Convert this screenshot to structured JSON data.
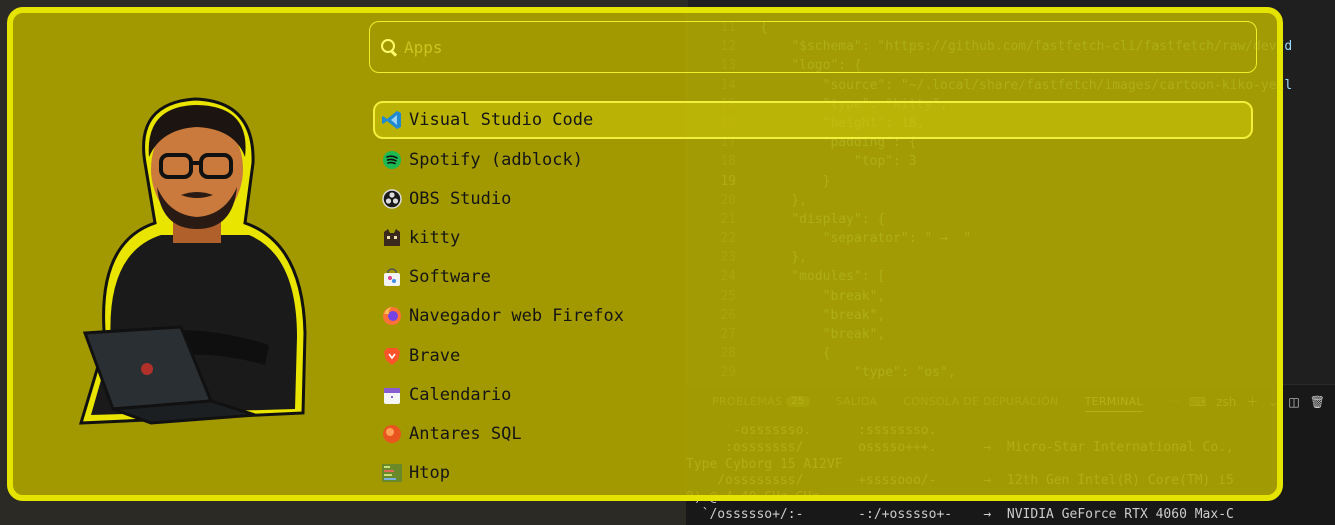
{
  "launcher": {
    "search_placeholder": "Apps",
    "apps": [
      {
        "label": "Visual Studio Code",
        "icon": "vscode-icon",
        "selected": true
      },
      {
        "label": "Spotify (adblock)",
        "icon": "spotify-icon"
      },
      {
        "label": "OBS Studio",
        "icon": "obs-icon"
      },
      {
        "label": "kitty",
        "icon": "kitty-icon"
      },
      {
        "label": "Software",
        "icon": "software-store-icon"
      },
      {
        "label": "Navegador web Firefox",
        "icon": "firefox-icon"
      },
      {
        "label": "Brave",
        "icon": "brave-icon"
      },
      {
        "label": "Calendario",
        "icon": "calendar-icon"
      },
      {
        "label": "Antares SQL",
        "icon": "antares-icon"
      },
      {
        "label": "Htop",
        "icon": "htop-icon"
      }
    ]
  },
  "editor": {
    "lines": [
      {
        "n": "11",
        "t": "{"
      },
      {
        "n": "12",
        "t": "    \"$schema\": \"https://github.com/fastfetch-cli/fastfetch/raw/dev/d"
      },
      {
        "n": "13",
        "t": "    \"logo\": {"
      },
      {
        "n": "14",
        "t": "        \"source\": \"~/.local/share/fastfetch/images/cartoon-kiko-yell"
      },
      {
        "n": "15",
        "t": "        \"type\": \"kitty\","
      },
      {
        "n": "16",
        "t": "        \"height\": 18,"
      },
      {
        "n": "17",
        "t": "        \"padding\": {"
      },
      {
        "n": "18",
        "t": "            \"top\": 3"
      },
      {
        "n": "19",
        "t": "        }"
      },
      {
        "n": "20",
        "t": "    },"
      },
      {
        "n": "21",
        "t": "    \"display\": {"
      },
      {
        "n": "22",
        "t": "        \"separator\": \" →  \""
      },
      {
        "n": "23",
        "t": "    },"
      },
      {
        "n": "24",
        "t": "    \"modules\": ["
      },
      {
        "n": "25",
        "t": "        \"break\","
      },
      {
        "n": "26",
        "t": "        \"break\","
      },
      {
        "n": "27",
        "t": "        \"break\","
      },
      {
        "n": "28",
        "t": "        {"
      },
      {
        "n": "29",
        "t": "            \"type\": \"os\","
      }
    ],
    "current_line": "19"
  },
  "panel": {
    "tabs": [
      {
        "label": "PROBLEMAS",
        "badge": "25"
      },
      {
        "label": "SALIDA"
      },
      {
        "label": "CONSOLA DE DEPURACIÓN"
      },
      {
        "label": "TERMINAL",
        "active": true
      },
      {
        "label": "···"
      }
    ],
    "shell_label": "zsh",
    "terminal_lines": [
      "      -osssssso.      :ssssssso.",
      "     :osssssss/       osssso+++.      →  Micro-Star International Co.,",
      "Type Cyborg 15 A12VF",
      "    /ossssssss/       +ssssooo/-      →  12th Gen Intel(R) Core(TM) i5",
      "8) @ 4.40 GHz GHz",
      "  `/ossssso+/:-       -:/+osssso+-    →  NVIDIA GeForce RTX 4060 Max-C"
    ]
  },
  "colors": {
    "launcher_border": "#e5e300",
    "launcher_bg": "#b0a800",
    "editor_bg": "#1f1f1f"
  }
}
